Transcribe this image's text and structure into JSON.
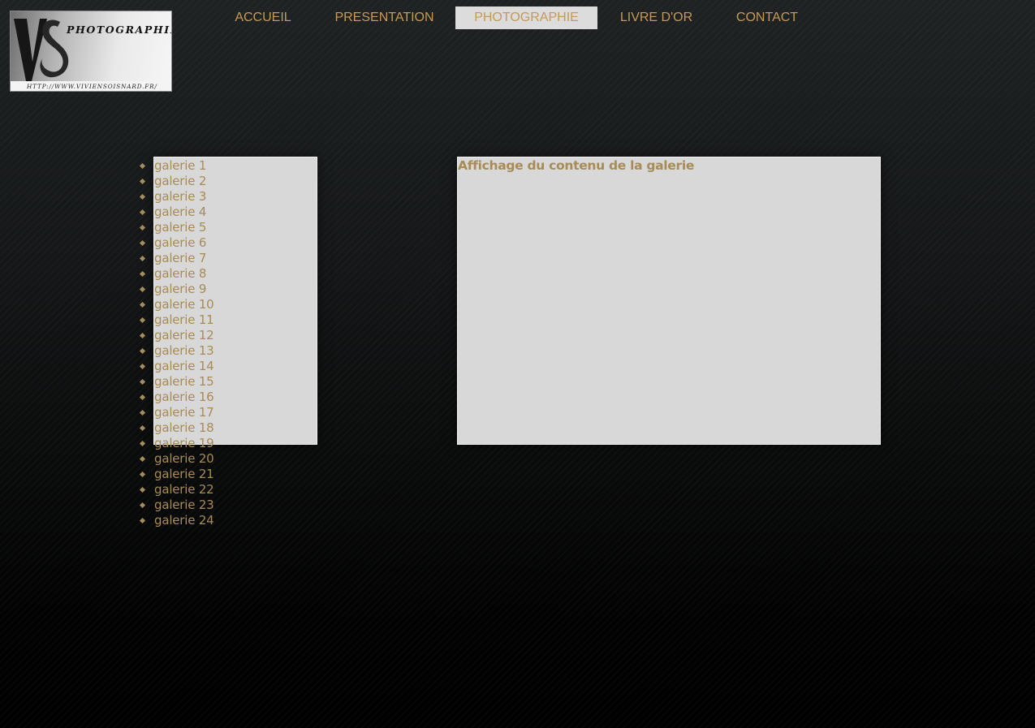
{
  "logo": {
    "icon": "vs-monogram-logo",
    "word": "PHOTOGRAPHIE",
    "url": "HTTP://WWW.VIVIENSOISNARD.FR/"
  },
  "nav": {
    "items": [
      {
        "label": "ACCUEIL",
        "active": false
      },
      {
        "label": "PRESENTATION",
        "active": false
      },
      {
        "label": "PHOTOGRAPHIE",
        "active": true
      },
      {
        "label": "LIVRE D'OR",
        "active": false
      },
      {
        "label": "CONTACT",
        "active": false
      }
    ]
  },
  "galleries": {
    "bullet_icon": "diamond-bullet-icon",
    "items": [
      "galerie 1",
      "galerie 2",
      "galerie 3",
      "galerie 4",
      "galerie 5",
      "galerie 6",
      "galerie 7",
      "galerie 8",
      "galerie 9",
      "galerie 10",
      "galerie 11",
      "galerie 12",
      "galerie 13",
      "galerie 14",
      "galerie 15",
      "galerie 16",
      "galerie 17",
      "galerie 18",
      "galerie 19",
      "galerie 20",
      "galerie 21",
      "galerie 22",
      "galerie 23",
      "galerie 24"
    ]
  },
  "content": {
    "heading": "Affichage du contenu de la galerie"
  },
  "colors": {
    "accent_gold": "#a88b55",
    "nav_text": "#c59a55",
    "panel_bg": "#d8d8d8",
    "active_tab_bg": "#dcdcdc",
    "page_bg_top": "#1e2223",
    "page_bg_bottom": "#000000"
  }
}
